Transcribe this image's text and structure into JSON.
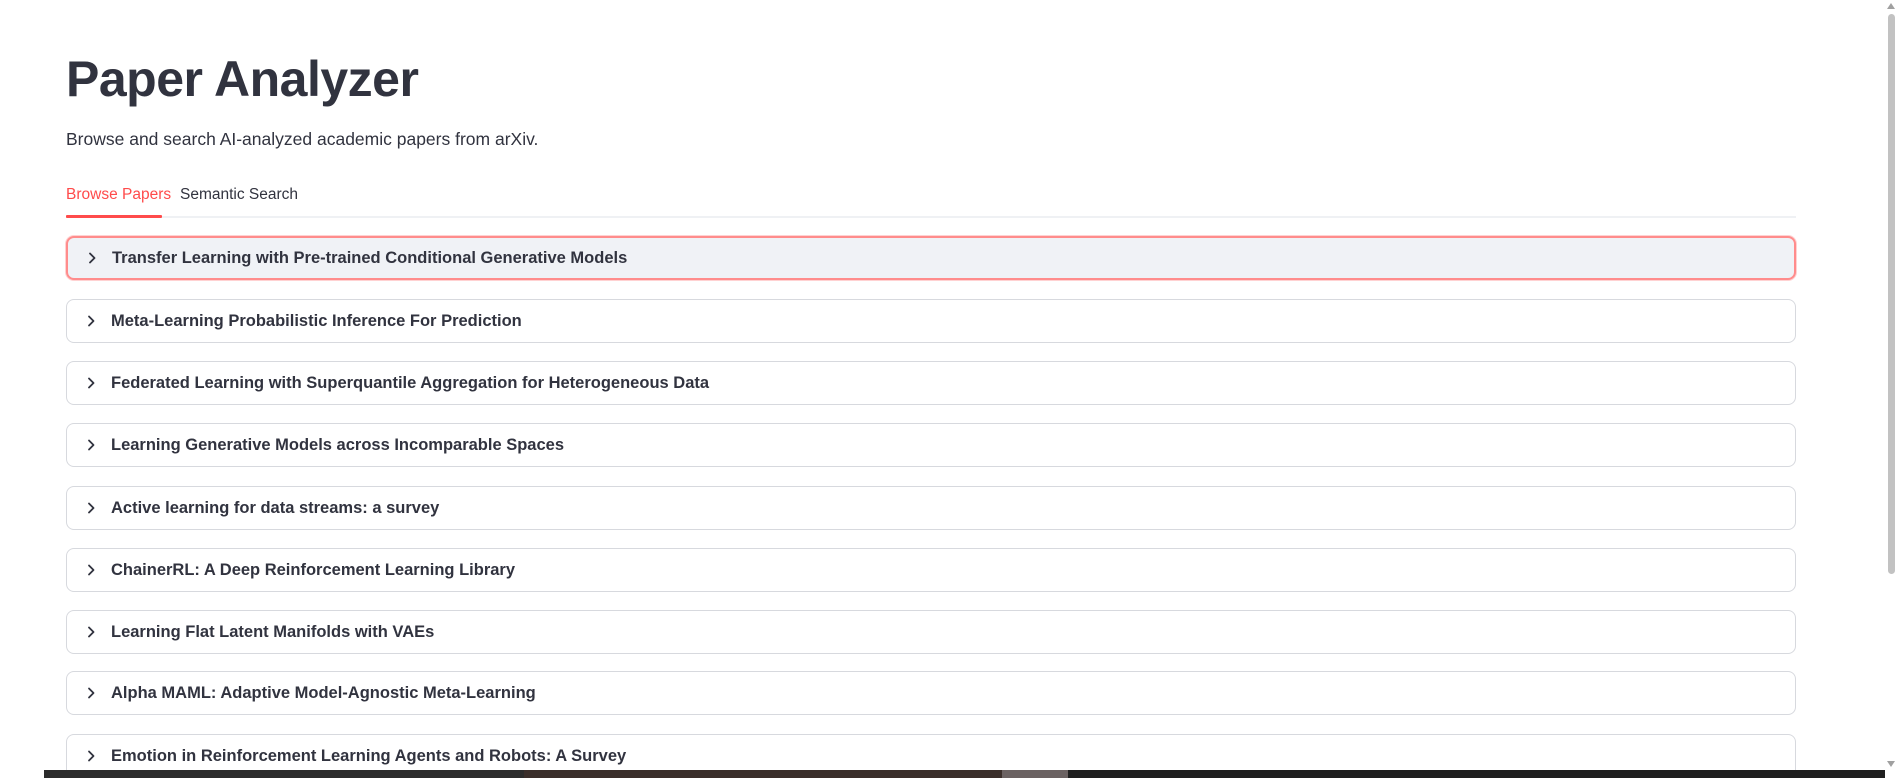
{
  "app": {
    "title": "Paper Analyzer",
    "subtitle": "Browse and search AI-analyzed academic papers from arXiv."
  },
  "tabs": [
    {
      "label": "Browse Papers",
      "active": true
    },
    {
      "label": "Semantic Search",
      "active": false
    }
  ],
  "papers": [
    {
      "title": "Transfer Learning with Pre-trained Conditional Generative Models",
      "expanded": false,
      "focused": true
    },
    {
      "title": "Meta-Learning Probabilistic Inference For Prediction",
      "expanded": false
    },
    {
      "title": "Federated Learning with Superquantile Aggregation for Heterogeneous Data",
      "expanded": false
    },
    {
      "title": "Learning Generative Models across Incomparable Spaces",
      "expanded": false
    },
    {
      "title": "Active learning for data streams: a survey",
      "expanded": false
    },
    {
      "title": "ChainerRL: A Deep Reinforcement Learning Library",
      "expanded": false
    },
    {
      "title": "Learning Flat Latent Manifolds with VAEs",
      "expanded": false
    },
    {
      "title": "Alpha MAML: Adaptive Model-Agnostic Meta-Learning",
      "expanded": false
    },
    {
      "title": "Emotion in Reinforcement Learning Agents and Robots: A Survey",
      "expanded": false
    }
  ],
  "icons": {
    "expander": "chevron-right-icon",
    "scroll_up": "scroll-up-arrow-icon",
    "scroll_down": "scroll-down-arrow-icon"
  },
  "colors": {
    "accent": "#ff4b4b",
    "text": "#31333f",
    "focused_bg": "#f0f2f6",
    "focused_border": "#ff8c8c",
    "border": "#d7d9de"
  }
}
